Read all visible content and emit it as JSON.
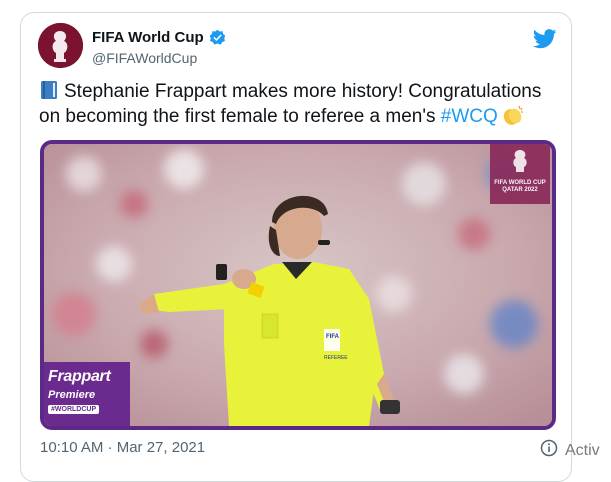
{
  "account": {
    "display_name": "FIFA World Cup",
    "handle": "@FIFAWorldCup"
  },
  "tweet": {
    "text_main": "Stephanie Frappart makes more history! Congratulations on becoming the first female to referee a men's ",
    "hashtag": "#WCQ",
    "timestamp": "10:10 AM · Mar 27, 2021"
  },
  "media": {
    "badge_title": "Frappart",
    "badge_subtitle": "Premiere",
    "badge_tag": "#WORLDCUP",
    "logo_text": "FIFA WORLD CUP QATAR 2022",
    "jersey_text_1": "FIFA",
    "jersey_text_2": "REFEREE"
  },
  "overlay": {
    "activate_text": "Activ"
  },
  "colors": {
    "accent_blue": "#1d9bf0",
    "media_border": "#5b2a86",
    "jersey_yellow": "#e8f23a"
  }
}
